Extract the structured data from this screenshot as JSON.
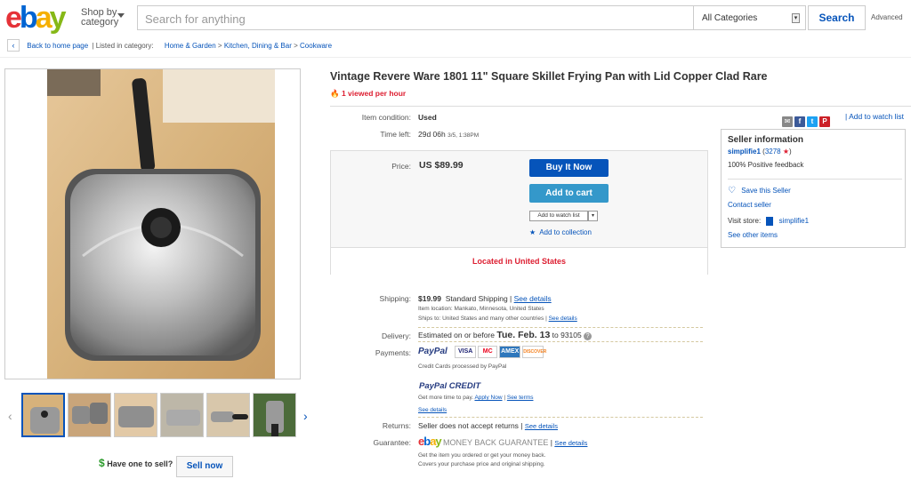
{
  "header": {
    "logo": [
      "e",
      "b",
      "a",
      "y"
    ],
    "logo_colors": [
      "#e53238",
      "#0064d2",
      "#f5af02",
      "#86b817"
    ],
    "shop_by": [
      "Shop by",
      "category"
    ],
    "search_placeholder": "Search for anything",
    "category": "All Categories",
    "search_button": "Search",
    "advanced": "Advanced"
  },
  "breadcrumb": {
    "back": "Back to home page",
    "listed_in": "| Listed in category:",
    "items": [
      "Home & Garden",
      "Kitchen, Dining & Bar",
      "Cookware"
    ],
    "sep": ">"
  },
  "gallery": {
    "thumb_count": 6,
    "have_one": "Have one to sell?",
    "sell_now": "Sell now"
  },
  "listing": {
    "title": "Vintage Revere Ware 1801 11\" Square Skillet Frying Pan with Lid Copper Clad Rare",
    "viewed": "1 viewed per hour",
    "condition_label": "Item condition:",
    "condition": "Used",
    "time_label": "Time left:",
    "time_left": "29d 06h",
    "time_end": "3/5, 1:38PM",
    "price_label": "Price:",
    "price": "US $89.99",
    "buy_now": "Buy It Now",
    "add_to_cart": "Add to cart",
    "add_watch": "Add to watch list",
    "add_collection": "Add to collection",
    "located": "Located in United States"
  },
  "shipping": {
    "label": "Shipping:",
    "cost": "$19.99",
    "method": "Standard Shipping",
    "see_details": "See details",
    "item_location": "Item location:  Mankato, Minnesota, United States",
    "ships_to": "Ships to:  United States and many other countries",
    "delivery_label": "Delivery:",
    "estimated": "Estimated on or before",
    "date": "Tue. Feb. 13",
    "to_zip": "to 93105"
  },
  "payments": {
    "label": "Payments:",
    "paypal": "PayPal",
    "cards": [
      "VISA",
      "MC",
      "AMEX",
      "DISCOVER"
    ],
    "card_colors": [
      "#1a1f71",
      "#eb001b",
      "#2e77bc",
      "#f58220"
    ],
    "processed": "Credit Cards processed by PayPal",
    "credit": "PayPal CREDIT",
    "more_time": "Get more time to pay.",
    "apply": "Apply Now",
    "terms": "See terms",
    "see_details": "See details"
  },
  "returns": {
    "label": "Returns:",
    "text": "Seller does not accept returns",
    "see_details": "See details"
  },
  "guarantee": {
    "label": "Guarantee:",
    "mbg": "MONEY BACK GUARANTEE",
    "see_details": "See details",
    "line1": "Get the item you ordered or get your money back.",
    "line2": "Covers your purchase price and original shipping."
  },
  "share": {
    "icons": [
      "email-icon",
      "facebook-icon",
      "twitter-icon",
      "pinterest-icon"
    ],
    "add_watch": "Add to watch list"
  },
  "seller": {
    "title": "Seller information",
    "name": "simplifie1",
    "score": "3278",
    "feedback": "100% Positive feedback",
    "save": "Save this Seller",
    "contact": "Contact seller",
    "visit": "Visit store:",
    "store": "simplifie1",
    "other": "See other items"
  }
}
